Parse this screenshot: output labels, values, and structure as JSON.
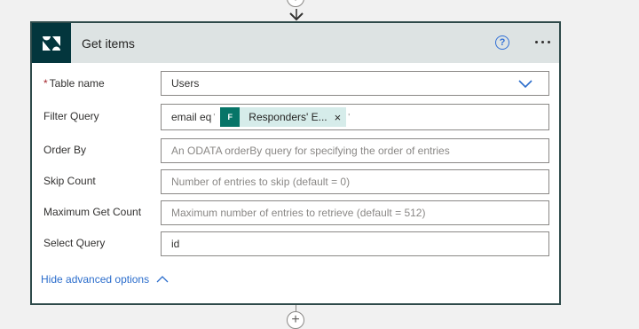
{
  "card": {
    "title": "Get items",
    "help_glyph": "?",
    "icons": {
      "logo": "zendesk-logo-icon",
      "help": "help-icon",
      "more": "more-options-icon"
    }
  },
  "fields": {
    "table_name": {
      "label": "Table name",
      "required": "*",
      "value": "Users"
    },
    "filter_query": {
      "label": "Filter Query",
      "prefix": "email eq",
      "quote_open": "'",
      "quote_close": "'",
      "token_label": "Responders' E...",
      "token_close": "×"
    },
    "order_by": {
      "label": "Order By",
      "placeholder": "An ODATA orderBy query for specifying the order of entries"
    },
    "skip_count": {
      "label": "Skip Count",
      "placeholder": "Number of entries to skip (default = 0)"
    },
    "max_get_count": {
      "label": "Maximum Get Count",
      "placeholder": "Maximum number of entries to retrieve (default = 512)"
    },
    "select_query": {
      "label": "Select Query",
      "value": "id"
    }
  },
  "advanced": {
    "label": "Hide advanced options"
  },
  "connector": {
    "plus_glyph": "+"
  },
  "colors": {
    "accent": "#2b6dcc",
    "header_bg": "#dde3e3",
    "logo_bg": "#03363d",
    "token_bg": "#d6ecea",
    "token_icon_bg": "#077568"
  }
}
